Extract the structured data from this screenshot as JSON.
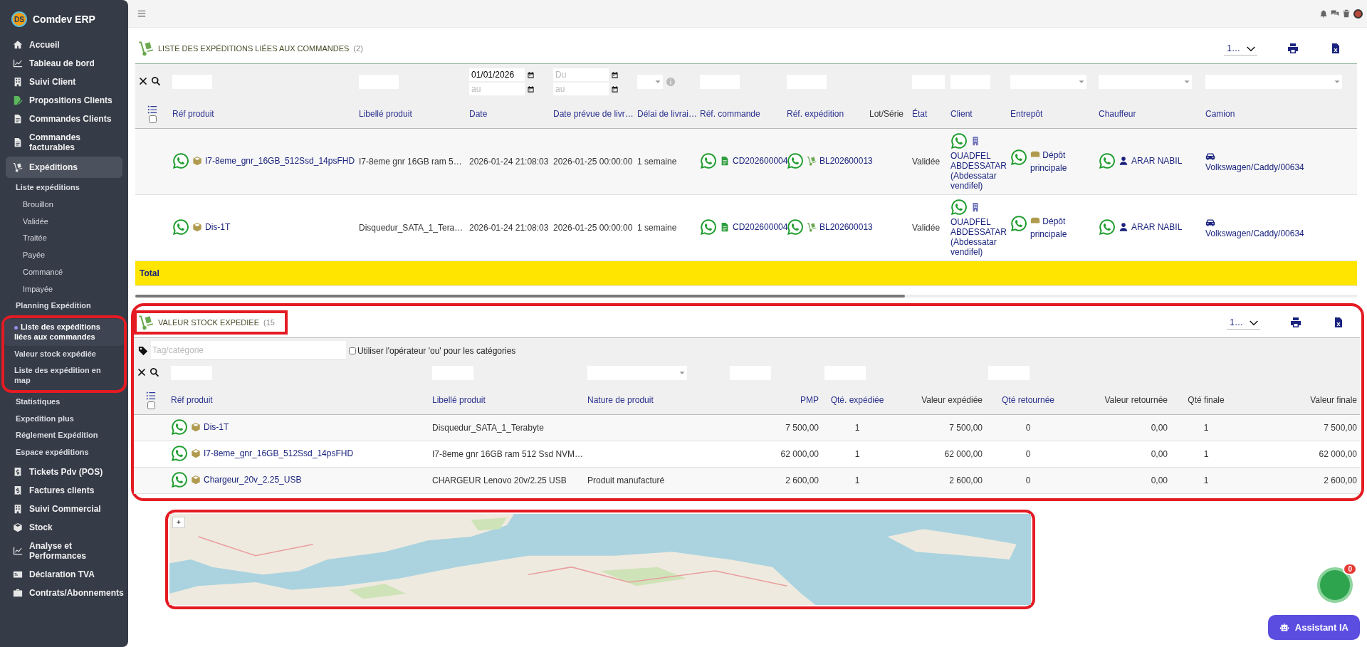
{
  "app": {
    "name": "Comdev ERP",
    "logo": "DS"
  },
  "sidebar": {
    "items": [
      {
        "label": "Accueil",
        "selected": false
      },
      {
        "label": "Tableau de bord",
        "selected": false
      },
      {
        "label": "Suivi Client",
        "selected": false
      },
      {
        "label": "Propositions Clients",
        "selected": false
      },
      {
        "label": "Commandes Clients",
        "selected": false
      },
      {
        "label": "Commandes facturables",
        "selected": false
      },
      {
        "label": "Expéditions",
        "selected": true,
        "children": [
          {
            "kind": "link",
            "label": "Liste expéditions",
            "selected": false,
            "children": [
              {
                "label": "Brouillon",
                "selected": false
              },
              {
                "label": "Validée",
                "selected": false
              },
              {
                "label": "Traitée",
                "selected": false
              },
              {
                "label": "Payée",
                "selected": false
              },
              {
                "label": "Commancé",
                "selected": false
              },
              {
                "label": "Impayée",
                "selected": false
              }
            ]
          },
          {
            "kind": "link",
            "label": "Planning Expédition",
            "selected": false
          },
          {
            "kind": "highlight",
            "children": [
              {
                "label": "Liste des expéditions liées aux commandes",
                "selected": true
              },
              {
                "label": "Valeur stock expédiée",
                "selected": false
              },
              {
                "label": "Liste des expédition en map",
                "selected": false
              }
            ]
          },
          {
            "kind": "link",
            "label": "Statistiques",
            "selected": false
          },
          {
            "kind": "link",
            "label": "Expedition plus",
            "selected": false
          },
          {
            "kind": "link",
            "label": "Réglement Expédition",
            "selected": false
          },
          {
            "kind": "link",
            "label": "Espace expéditions",
            "selected": false
          }
        ]
      },
      {
        "label": "Tickets Pdv (POS)",
        "selected": false
      },
      {
        "label": "Factures clients",
        "selected": false
      },
      {
        "label": "Suivi Commercial",
        "selected": false
      },
      {
        "label": "Stock",
        "selected": false
      },
      {
        "label": "Analyse et Performances",
        "selected": false
      },
      {
        "label": "Déclaration TVA",
        "selected": false
      },
      {
        "label": "Contrats/Abonnements",
        "selected": false
      }
    ]
  },
  "shipments_section": {
    "title": "LISTE DES EXPÉDITIONS LIÉES AUX COMMANDES",
    "count": "(2)",
    "highlighted": false,
    "title_highlighted": false,
    "page_size": "1…",
    "table": {
      "select_all": {
        "checked": false
      },
      "columns": [
        {
          "label": "Réf produit",
          "sortable": true,
          "filter": {
            "kind": "text"
          }
        },
        {
          "label": "Libellé produit",
          "sortable": true,
          "filter": {
            "kind": "text"
          }
        },
        {
          "label": "Date",
          "sortable": true,
          "filter": {
            "kind": "date-range",
            "from_value": "01/01/2026",
            "to_placeholder": "au"
          }
        },
        {
          "label": "Date prévue de livr…",
          "sortable": true,
          "filter": {
            "kind": "date-range",
            "from_placeholder": "Du",
            "to_placeholder": "au"
          }
        },
        {
          "label": "Délai de livrai…",
          "sortable": true,
          "filter": {
            "kind": "select-info"
          }
        },
        {
          "label": "Réf. commande",
          "sortable": true,
          "filter": {
            "kind": "text"
          }
        },
        {
          "label": "Réf. expédition",
          "sortable": true,
          "filter": {
            "kind": "text"
          }
        },
        {
          "label": "Lot/Série",
          "sortable": false,
          "filter": {
            "kind": "none"
          }
        },
        {
          "label": "État",
          "sortable": true,
          "filter": {
            "kind": "text"
          }
        },
        {
          "label": "Client",
          "sortable": true,
          "filter": {
            "kind": "text"
          }
        },
        {
          "label": "Entrepôt",
          "sortable": true,
          "filter": {
            "kind": "select"
          }
        },
        {
          "label": "Chauffeur",
          "sortable": true,
          "filter": {
            "kind": "select"
          }
        },
        {
          "label": "Camion",
          "sortable": true,
          "filter": {
            "kind": "select"
          }
        }
      ],
      "rows": [
        {
          "cells": [
            {
              "kind": "product",
              "text": "I7-8eme_gnr_16GB_512Ssd_14psFHD"
            },
            {
              "kind": "text",
              "text": "I7-8eme gnr 16GB ram 5…"
            },
            {
              "kind": "text",
              "text": "2026-01-24 21:08:03"
            },
            {
              "kind": "text",
              "text": "2026-01-25 00:00:00"
            },
            {
              "kind": "text",
              "text": "1 semaine"
            },
            {
              "kind": "order",
              "text": "CD202600004"
            },
            {
              "kind": "shipment",
              "text": "BL202600013"
            },
            {
              "kind": "blank"
            },
            {
              "kind": "text",
              "text": "Validée"
            },
            {
              "kind": "client",
              "text": "OUADFEL ABDESSATAR (Abdessatar vendifel)"
            },
            {
              "kind": "warehouse",
              "text": "Dépôt principale"
            },
            {
              "kind": "driver",
              "text": "ARAR NABIL"
            },
            {
              "kind": "truck",
              "text": "Volkswagen/Caddy/00634"
            }
          ]
        },
        {
          "cells": [
            {
              "kind": "product",
              "text": "Dis-1T"
            },
            {
              "kind": "text",
              "text": "Disquedur_SATA_1_Tera…"
            },
            {
              "kind": "text",
              "text": "2026-01-24 21:08:03"
            },
            {
              "kind": "text",
              "text": "2026-01-25 00:00:00"
            },
            {
              "kind": "text",
              "text": "1 semaine"
            },
            {
              "kind": "order",
              "text": "CD202600004"
            },
            {
              "kind": "shipment",
              "text": "BL202600013"
            },
            {
              "kind": "blank"
            },
            {
              "kind": "text",
              "text": "Validée"
            },
            {
              "kind": "client",
              "text": "OUADFEL ABDESSATAR (Abdessatar vendifel)"
            },
            {
              "kind": "warehouse",
              "text": "Dépôt principale"
            },
            {
              "kind": "driver",
              "text": "ARAR NABIL"
            },
            {
              "kind": "truck",
              "text": "Volkswagen/Caddy/00634"
            }
          ]
        }
      ],
      "total_label": "Total"
    }
  },
  "stock_section": {
    "title": "VALEUR STOCK EXPEDIEE",
    "count": "(15",
    "highlighted": true,
    "title_highlighted": true,
    "page_size": "1…",
    "tag_filter": {
      "placeholder": "Tag/catégorie",
      "or_operator": {
        "label": "Utiliser l'opérateur 'ou' pour les catégories",
        "checked": false
      }
    },
    "table": {
      "select_all": {
        "checked": false
      },
      "columns": [
        {
          "label": "Réf produit",
          "sortable": true,
          "kind": "text",
          "filter": {
            "kind": "text"
          }
        },
        {
          "label": "Libellé produit",
          "sortable": true,
          "kind": "text",
          "filter": {
            "kind": "text"
          }
        },
        {
          "label": "Nature de produit",
          "sortable": true,
          "kind": "text",
          "filter": {
            "kind": "select"
          }
        },
        {
          "label": "PMP",
          "sortable": true,
          "kind": "number",
          "filter": {
            "kind": "text"
          }
        },
        {
          "label": "Qté. expédiée",
          "sortable": true,
          "kind": "qty",
          "filter": {
            "kind": "text"
          }
        },
        {
          "label": "Valeur expédiée",
          "sortable": false,
          "kind": "number",
          "filter": {
            "kind": "none"
          }
        },
        {
          "label": "Qté retournée",
          "sortable": true,
          "kind": "qty",
          "filter": {
            "kind": "text"
          }
        },
        {
          "label": "Valeur retournée",
          "sortable": false,
          "kind": "number",
          "filter": {
            "kind": "none"
          }
        },
        {
          "label": "Qté finale",
          "sortable": false,
          "kind": "qty",
          "filter": {
            "kind": "none"
          }
        },
        {
          "label": "Valeur finale",
          "sortable": false,
          "kind": "number",
          "filter": {
            "kind": "none"
          }
        }
      ],
      "rows": [
        {
          "cells": [
            {
              "kind": "product",
              "text": "Dis-1T"
            },
            {
              "kind": "text",
              "text": "Disquedur_SATA_1_Terabyte"
            },
            {
              "kind": "blank"
            },
            {
              "kind": "text",
              "text": "7 500,00"
            },
            {
              "kind": "text",
              "text": "1"
            },
            {
              "kind": "text",
              "text": "7 500,00"
            },
            {
              "kind": "text",
              "text": "0"
            },
            {
              "kind": "text",
              "text": "0,00"
            },
            {
              "kind": "text",
              "text": "1"
            },
            {
              "kind": "text",
              "text": "7 500,00"
            }
          ]
        },
        {
          "cells": [
            {
              "kind": "product",
              "text": "I7-8eme_gnr_16GB_512Ssd_14psFHD"
            },
            {
              "kind": "text",
              "text": "I7-8eme gnr 16GB ram 512 Ssd NVM…"
            },
            {
              "kind": "blank"
            },
            {
              "kind": "text",
              "text": "62 000,00"
            },
            {
              "kind": "text",
              "text": "1"
            },
            {
              "kind": "text",
              "text": "62 000,00"
            },
            {
              "kind": "text",
              "text": "0"
            },
            {
              "kind": "text",
              "text": "0,00"
            },
            {
              "kind": "text",
              "text": "1"
            },
            {
              "kind": "text",
              "text": "62 000,00"
            }
          ]
        },
        {
          "cells": [
            {
              "kind": "product",
              "text": "Chargeur_20v_2.25_USB"
            },
            {
              "kind": "text",
              "text": "CHARGEUR Lenovo 20v/2.25 USB"
            },
            {
              "kind": "text",
              "text": "Produit manufacturé"
            },
            {
              "kind": "text",
              "text": "2 600,00"
            },
            {
              "kind": "text",
              "text": "1"
            },
            {
              "kind": "text",
              "text": "2 600,00"
            },
            {
              "kind": "text",
              "text": "0"
            },
            {
              "kind": "text",
              "text": "0,00"
            },
            {
              "kind": "text",
              "text": "1"
            },
            {
              "kind": "text",
              "text": "2 600,00"
            }
          ]
        }
      ]
    }
  },
  "map": {
    "highlighted": true,
    "zoom_label": "+"
  },
  "chat_bubble": {
    "badge": "0"
  },
  "assistant_button": {
    "label": "Assistant IA"
  }
}
